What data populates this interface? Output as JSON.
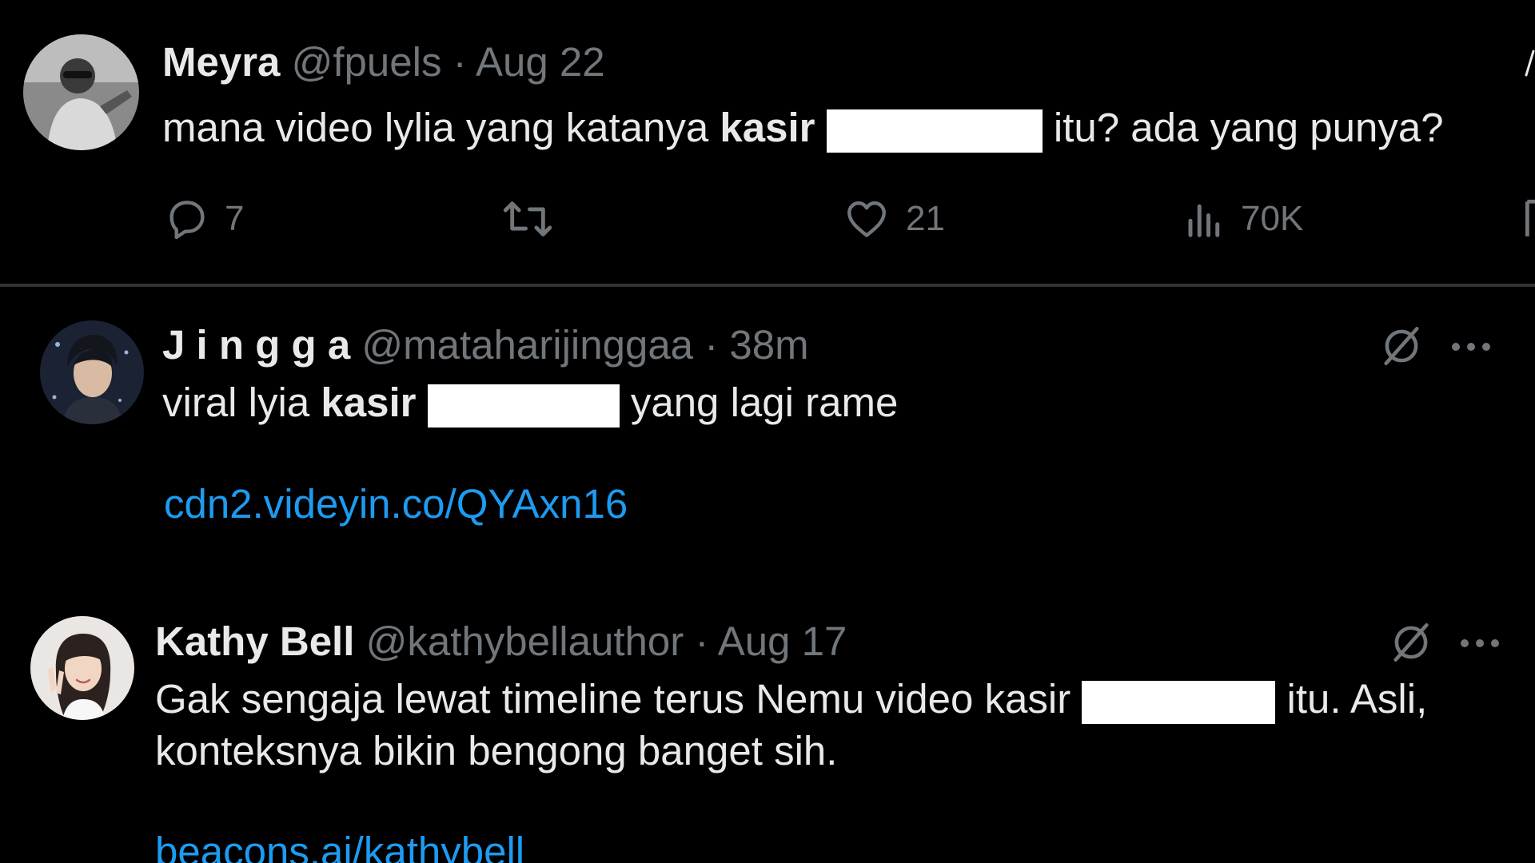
{
  "colors": {
    "background": "#000000",
    "text": "#e7e9ea",
    "muted": "#71767b",
    "link": "#1d9bf0",
    "divider": "#2f3336",
    "redaction": "#ffffff"
  },
  "tweets": [
    {
      "name": "Meyra",
      "handle": "@fpuels",
      "separator": "·",
      "time": "Aug 22",
      "avatar_icon": "user-avatar",
      "text_before": "mana video lylia yang katanya",
      "text_bold": "kasir",
      "text_after": "itu? ada yang punya?",
      "actions": {
        "reply_count": "7",
        "like_count": "21",
        "views_count": "70K"
      }
    },
    {
      "name": "J i n g g a",
      "handle": "@mataharijinggaa",
      "separator": "·",
      "time": "38m",
      "avatar_icon": "user-avatar",
      "text_before": "viral lyia",
      "text_bold": "kasir",
      "text_after": "yang lagi rame",
      "link": "cdn2.videyin.co/QYAxn16",
      "grok_icon": "grok-icon",
      "more_icon": "more-icon"
    },
    {
      "name": "Kathy Bell",
      "handle": "@kathybellauthor",
      "separator": "·",
      "time": "Aug 17",
      "avatar_icon": "user-avatar",
      "text_before": "Gak sengaja lewat timeline terus Nemu video kasir",
      "text_after": "itu. Asli,",
      "text_line2": "konteksnya bikin bengong banget sih.",
      "link": "beacons.ai/kathybell",
      "grok_icon": "grok-icon",
      "more_icon": "more-icon"
    }
  ]
}
